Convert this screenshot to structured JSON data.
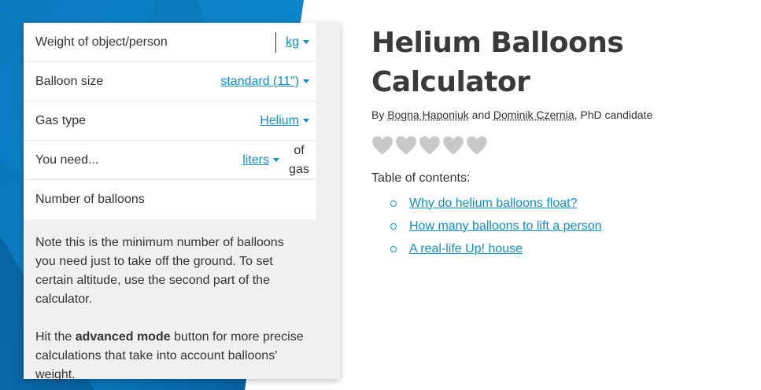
{
  "calculator": {
    "rows": [
      {
        "label": "Weight of object/person",
        "unit": "kg"
      },
      {
        "label": "Balloon size",
        "unit": "standard (11\")"
      },
      {
        "label": "Gas type",
        "unit": "Helium"
      },
      {
        "label": "You need...",
        "unit": "liters",
        "suffix_line1": "of",
        "suffix_line2": "gas"
      },
      {
        "label": "Number of balloons"
      }
    ],
    "note_p1": "Note this is the minimum number of balloons you need just to take off the ground. To set certain altitude, use the second part of the calculator.",
    "note_p2_before": "Hit the ",
    "note_p2_bold": "advanced mode",
    "note_p2_after": " button for more precise calculations that take into account balloons' weight."
  },
  "header": {
    "title": "Helium Balloons Calculator",
    "by": "By ",
    "author1": "Bogna Haponiuk",
    "and": " and ",
    "author2": "Dominik Czernia",
    "suffix": ", PhD candidate"
  },
  "rating": {
    "filled": 0,
    "max": 5,
    "color": "#c8c8c8"
  },
  "toc": {
    "title": "Table of contents:",
    "items": [
      "Why do helium balloons float?",
      "How many balloons to lift a person",
      "A real-life Up! house"
    ]
  },
  "colors": {
    "accent": "#0e8fc9",
    "background_blue": "#0a6fb0"
  }
}
